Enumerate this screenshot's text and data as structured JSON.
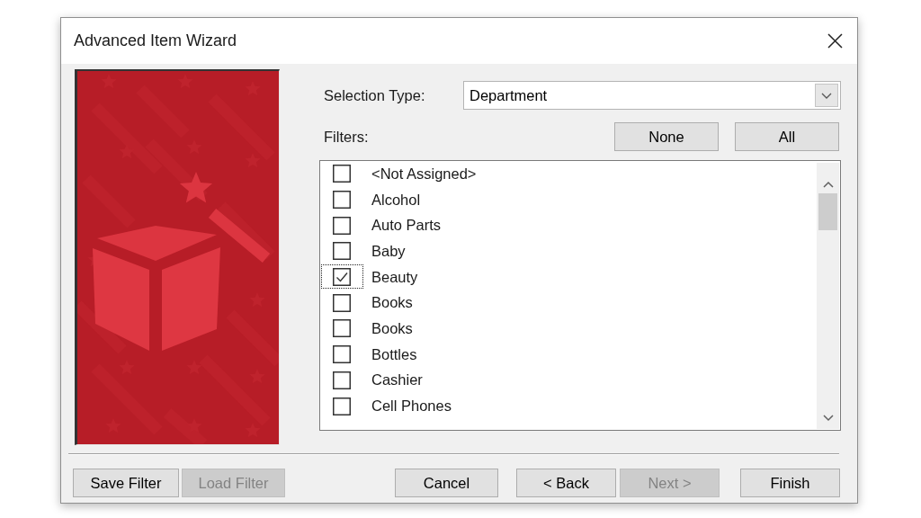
{
  "window": {
    "title": "Advanced Item Wizard"
  },
  "selection_type": {
    "label": "Selection Type:",
    "value": "Department"
  },
  "filters": {
    "label": "Filters:",
    "buttons": [
      "None",
      "All"
    ],
    "items": [
      {
        "label": "<Not Assigned>",
        "checked": false,
        "focused": false
      },
      {
        "label": "Alcohol",
        "checked": false,
        "focused": false
      },
      {
        "label": "Auto Parts",
        "checked": false,
        "focused": false
      },
      {
        "label": "Baby",
        "checked": false,
        "focused": false
      },
      {
        "label": "Beauty",
        "checked": true,
        "focused": true
      },
      {
        "label": "Books",
        "checked": false,
        "focused": false
      },
      {
        "label": "Books",
        "checked": false,
        "focused": false
      },
      {
        "label": "Bottles",
        "checked": false,
        "focused": false
      },
      {
        "label": "Cashier",
        "checked": false,
        "focused": false
      },
      {
        "label": "Cell Phones",
        "checked": false,
        "focused": false
      }
    ]
  },
  "footer": {
    "left_buttons": [
      {
        "label": "Save Filter",
        "disabled": false
      },
      {
        "label": "Load Filter",
        "disabled": true
      }
    ],
    "right_buttons": [
      {
        "label": "Cancel",
        "disabled": false
      },
      {
        "label": "< Back",
        "disabled": false
      },
      {
        "label": "Next >",
        "disabled": true
      },
      {
        "label": "Finish",
        "disabled": false
      }
    ]
  }
}
